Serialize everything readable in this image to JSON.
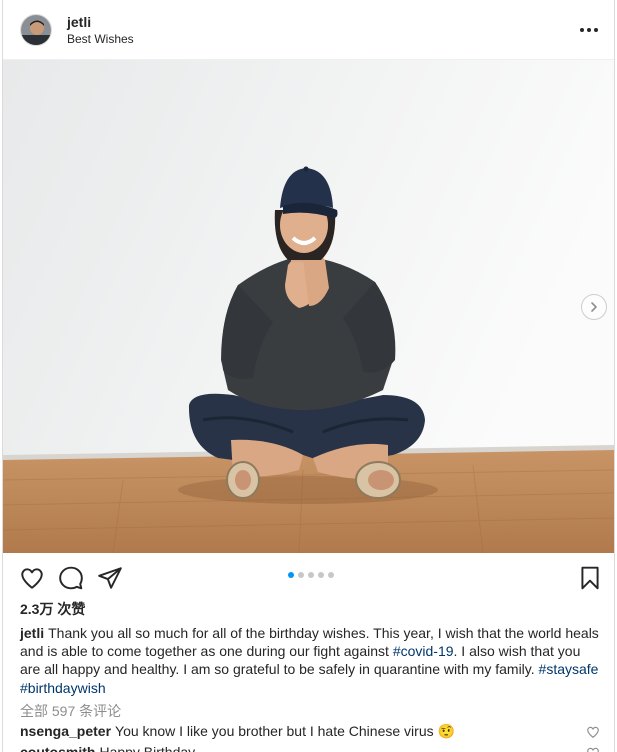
{
  "header": {
    "username": "jetli",
    "location": "Best Wishes",
    "more_icon": "more-horizontal-icon"
  },
  "carousel": {
    "dot_count": 5,
    "active_index": 0,
    "next_icon": "chevron-right-icon"
  },
  "actions": {
    "like_icon": "heart-icon",
    "comment_icon": "comment-icon",
    "share_icon": "paper-plane-icon",
    "save_icon": "bookmark-icon"
  },
  "likes": "2.3万 次赞",
  "caption": {
    "username": "jetli",
    "text_1": "Thank you all so much for all of the birthday wishes. This year, I wish that the world heals and is able to come together as one during our fight against ",
    "tag_1": "#covid-19",
    "text_2": ". I also wish that you are all happy and healthy. I am so grateful to be safely in quarantine with my family. ",
    "tag_2": "#staysafe",
    "tag_3": "#birthdaywish"
  },
  "view_all_comments": "全部 597 条评论",
  "comments": [
    {
      "username": "nsenga_peter",
      "text": "You know I like you brother but I hate Chinese virus 🤨"
    },
    {
      "username": "coutosmith",
      "text": "Happy Birthday"
    }
  ],
  "colors": {
    "link_blue": "#00376b",
    "active_dot": "#0095f6",
    "muted_text": "#8e8e8e"
  }
}
